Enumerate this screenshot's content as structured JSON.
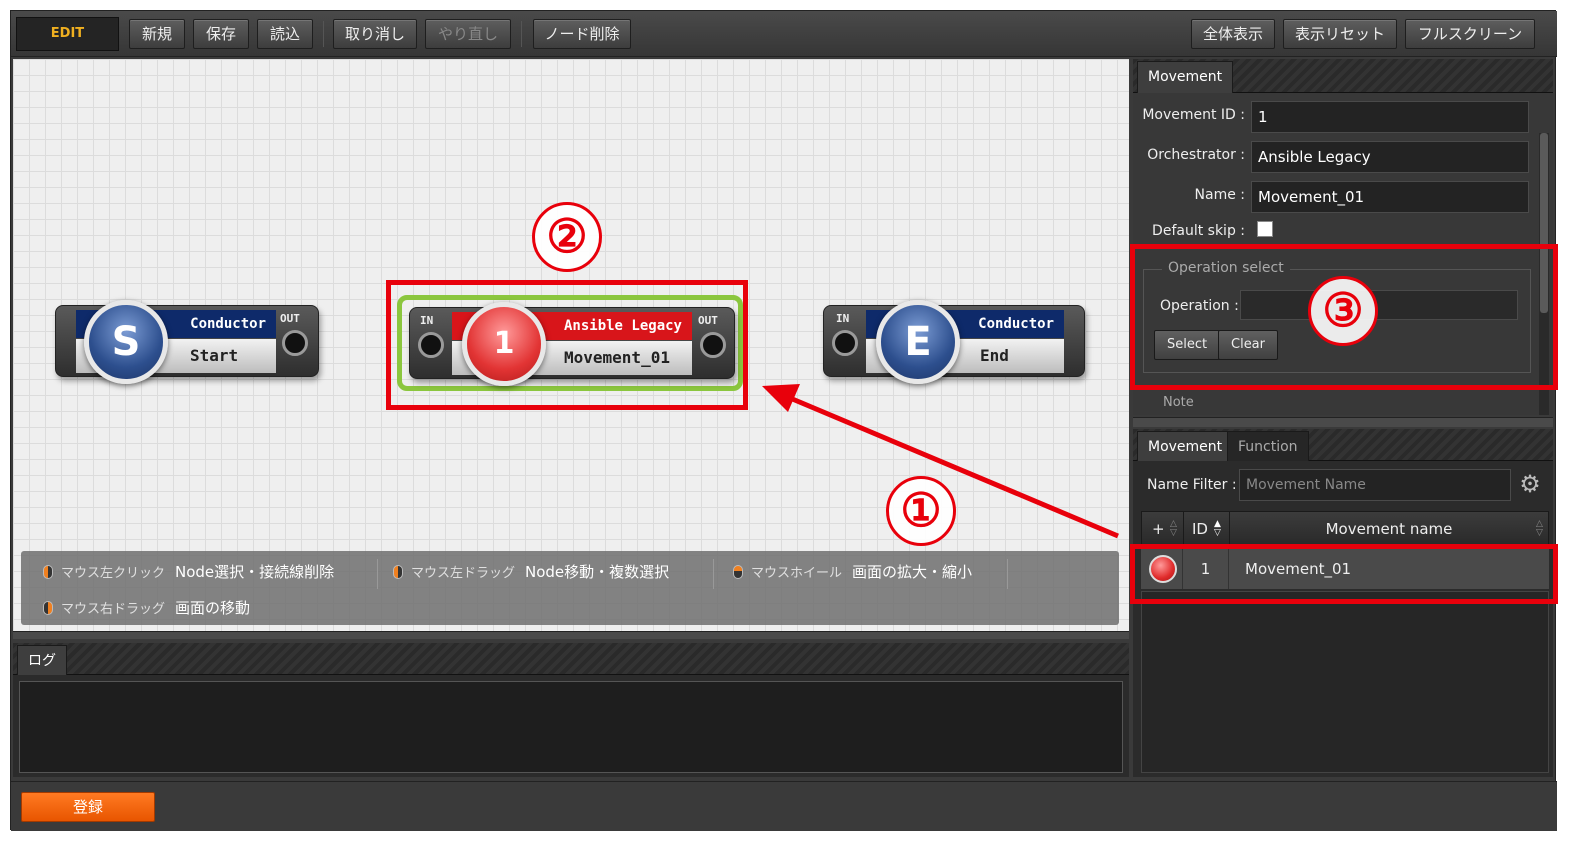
{
  "toolbar": {
    "mode": "EDIT",
    "new": "新規",
    "save": "保存",
    "load": "読込",
    "undo": "取り消し",
    "redo": "やり直し",
    "delete_node": "ノード削除",
    "show_all": "全体表示",
    "reset_view": "表示リセット",
    "fullscreen": "フルスクリーン"
  },
  "canvas": {
    "nodes": [
      {
        "type": "Conductor",
        "symbol": "S",
        "name": "Start",
        "port_out": "OUT"
      },
      {
        "type": "Ansible Legacy",
        "symbol": "1",
        "name": "Movement_01",
        "port_in": "IN",
        "port_out": "OUT"
      },
      {
        "type": "Conductor",
        "symbol": "E",
        "name": "End",
        "port_in": "IN"
      }
    ],
    "hints": [
      {
        "key": "マウス左クリック",
        "action": "Node選択・接続線削除"
      },
      {
        "key": "マウス左ドラッグ",
        "action": "Node移動・複数選択"
      },
      {
        "key": "マウスホイール",
        "action": "画面の拡大・縮小"
      },
      {
        "key": "マウス右ドラッグ",
        "action": "画面の移動"
      }
    ]
  },
  "log_panel": {
    "tab": "ログ"
  },
  "footer": {
    "register": "登録"
  },
  "properties": {
    "tab": "Movement",
    "movement_id_label": "Movement ID :",
    "movement_id": "1",
    "orchestrator_label": "Orchestrator :",
    "orchestrator": "Ansible Legacy",
    "name_label": "Name :",
    "name": "Movement_01",
    "default_skip_label": "Default skip :",
    "default_skip": false,
    "operation_legend": "Operation select",
    "operation_label": "Operation :",
    "operation_value": "",
    "select_btn": "Select",
    "clear_btn": "Clear",
    "note_legend": "Note"
  },
  "list_panel": {
    "tabs": [
      "Movement",
      "Function"
    ],
    "filter_label": "Name Filter :",
    "filter_placeholder": "Movement Name",
    "columns": {
      "add": "+",
      "id": "ID",
      "name": "Movement name"
    },
    "rows": [
      {
        "id": "1",
        "name": "Movement_01"
      }
    ]
  },
  "annotations": {
    "one": "①",
    "two": "②",
    "three": "③"
  },
  "colors": {
    "annotation": "#e8000b",
    "node_selected": "#8bc63e",
    "register": "#f06010",
    "conductor": "#0e2a6a",
    "movement": "#d8151a"
  }
}
